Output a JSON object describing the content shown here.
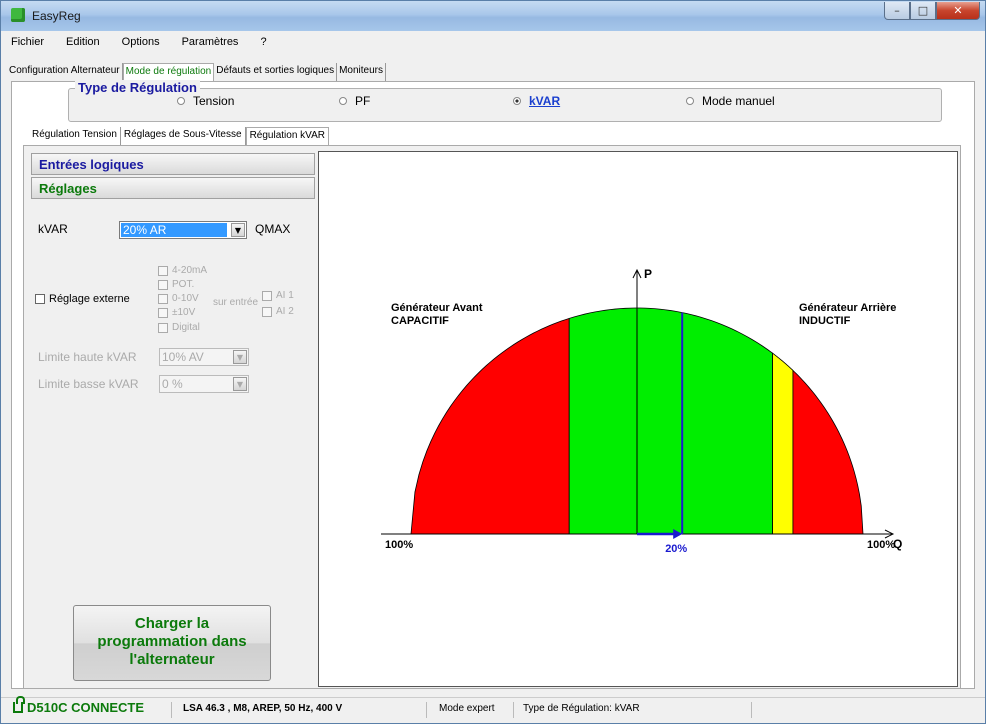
{
  "window": {
    "title": "EasyReg"
  },
  "menu": [
    "Fichier",
    "Edition",
    "Options",
    "Paramètres",
    "?"
  ],
  "top_tabs": [
    "Configuration Alternateur",
    "Mode de régulation",
    "Défauts et sorties logiques",
    "Moniteurs"
  ],
  "type_regulation": {
    "label": "Type de Régulation",
    "options": [
      "Tension",
      "PF",
      "kVAR",
      "Mode manuel"
    ],
    "selected": "kVAR"
  },
  "sub_tabs": [
    "Régulation Tension",
    "Réglages de Sous-Vitesse",
    "Régulation kVAR"
  ],
  "left_panel": {
    "section1": "Entrées logiques",
    "section2": "Réglages",
    "kvar_label": "kVAR",
    "kvar_value": "20% AR",
    "qmax_label": "QMAX",
    "reglage_externe": "Réglage externe",
    "inputs": [
      "4-20mA",
      "POT.",
      "0-10V",
      "±10V",
      "Digital"
    ],
    "sur_entree": "sur entrée",
    "ai": [
      "AI 1",
      "AI 2"
    ],
    "limite_haute_label": "Limite haute kVAR",
    "limite_haute_value": "10% AV",
    "limite_basse_label": "Limite basse kVAR",
    "limite_basse_value": "0 %",
    "load_button": [
      "Charger la",
      "programmation dans",
      "l'alternateur"
    ]
  },
  "chart_data": {
    "type": "area",
    "title": "",
    "axis_y_label": "P",
    "axis_x_label": "Q",
    "x_left_label": "100%",
    "x_right_label": "100%",
    "left_annotation": [
      "Générateur Avant",
      "CAPACITIF"
    ],
    "right_annotation": [
      "Générateur Arrière",
      "INDUCTIF"
    ],
    "setpoint_label": "20%",
    "setpoint": 0.2,
    "xlim": [
      -1,
      1
    ],
    "ylim": [
      0,
      1
    ],
    "zones": [
      {
        "name": "red-left",
        "x_from": -1.0,
        "x_to": -0.3,
        "color": "#ff0000"
      },
      {
        "name": "green",
        "x_from": -0.3,
        "x_to": 0.6,
        "color": "#00ee00"
      },
      {
        "name": "yellow",
        "x_from": 0.6,
        "x_to": 0.69,
        "color": "#ffff00"
      },
      {
        "name": "red-right",
        "x_from": 0.69,
        "x_to": 1.0,
        "color": "#ff0000"
      }
    ],
    "setpoint_line_x": 0.2
  },
  "status": {
    "connection": "D510C CONNECTE",
    "machine": "LSA 46.3 , M8, AREP, 50 Hz, 400 V",
    "mode": "Mode expert",
    "type": "Type de Régulation: kVAR"
  }
}
